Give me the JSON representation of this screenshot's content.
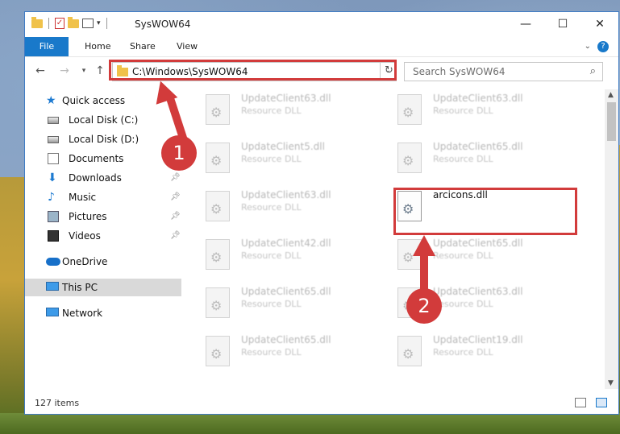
{
  "window": {
    "title": "SysWOW64"
  },
  "ribbon": {
    "tabs": [
      "File",
      "Home",
      "Share",
      "View"
    ],
    "help_glyph": "?"
  },
  "address_bar": {
    "path": "C:\\Windows\\SysWOW64"
  },
  "search": {
    "placeholder": "Search SysWOW64"
  },
  "sidebar": {
    "items": [
      {
        "label": "Quick access",
        "icon": "star-icon",
        "pinned": false
      },
      {
        "label": "Local Disk (C:)",
        "icon": "drive-icon",
        "pinned": false
      },
      {
        "label": "Local Disk (D:)",
        "icon": "drive-icon",
        "pinned": false
      },
      {
        "label": "Documents",
        "icon": "documents-icon",
        "pinned": false
      },
      {
        "label": "Downloads",
        "icon": "download-icon",
        "pinned": true
      },
      {
        "label": "Music",
        "icon": "music-icon",
        "pinned": true
      },
      {
        "label": "Pictures",
        "icon": "pictures-icon",
        "pinned": true
      },
      {
        "label": "Videos",
        "icon": "videos-icon",
        "pinned": true
      },
      {
        "label": "OneDrive",
        "icon": "cloud-icon",
        "pinned": false
      },
      {
        "label": "This PC",
        "icon": "computer-icon",
        "pinned": false,
        "selected": true
      },
      {
        "label": "Network",
        "icon": "network-icon",
        "pinned": false
      }
    ]
  },
  "files": [
    {
      "name": "UpdateClient63.dll",
      "type": "Resource DLL"
    },
    {
      "name": "UpdateClient63.dll",
      "type": "Resource DLL"
    },
    {
      "name": "UpdateClient5.dll",
      "type": "Resource DLL"
    },
    {
      "name": "UpdateClient65.dll",
      "type": "Resource DLL"
    },
    {
      "name": "UpdateClient63.dll",
      "type": "Resource DLL"
    },
    {
      "name": "arcicons.dll",
      "type": "",
      "highlighted": true
    },
    {
      "name": "UpdateClient42.dll",
      "type": "Resource DLL"
    },
    {
      "name": "UpdateClient65.dll",
      "type": "Resource DLL"
    },
    {
      "name": "UpdateClient65.dll",
      "type": "Resource DLL"
    },
    {
      "name": "UpdateClient63.dll",
      "type": "Resource DLL"
    },
    {
      "name": "UpdateClient65.dll",
      "type": "Resource DLL"
    },
    {
      "name": "UpdateClient19.dll",
      "type": "Resource DLL"
    }
  ],
  "status": {
    "item_count": "127 items"
  },
  "callouts": [
    {
      "label": "1"
    },
    {
      "label": "2"
    }
  ],
  "colors": {
    "accent": "#1979ca",
    "annotation_red": "#d23b3b",
    "selection": "#d9d9d9"
  }
}
